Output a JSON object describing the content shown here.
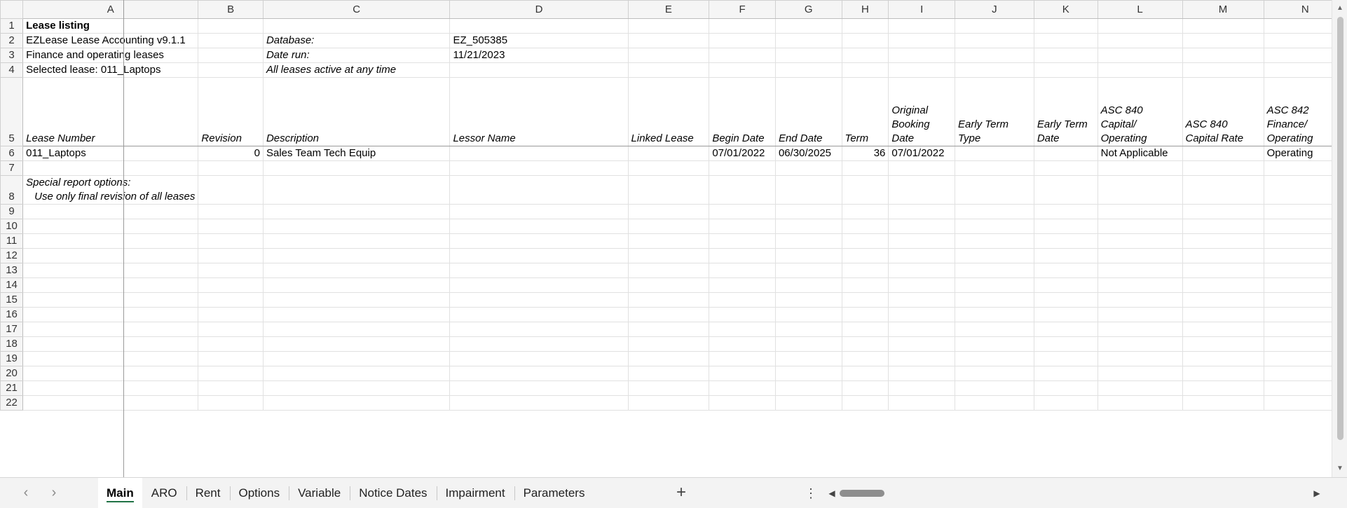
{
  "columns": [
    "A",
    "B",
    "C",
    "D",
    "E",
    "F",
    "G",
    "H",
    "I",
    "J",
    "K",
    "L",
    "M",
    "N"
  ],
  "rows": [
    {
      "num": "1",
      "cells": {
        "A": "Lease listing"
      }
    },
    {
      "num": "2",
      "cells": {
        "A": "EZLease Lease Accounting v9.1.1",
        "C": "Database:",
        "D": "EZ_505385"
      }
    },
    {
      "num": "3",
      "cells": {
        "A": "Finance and operating leases",
        "C": "Date run:",
        "D": "11/21/2023"
      }
    },
    {
      "num": "4",
      "cells": {
        "A": "Selected lease: 011_Laptops",
        "C": "All leases active at any time"
      }
    },
    {
      "num": "5",
      "cells": {
        "A": "Lease Number",
        "B": "Revision",
        "C": "Description",
        "D": "Lessor Name",
        "E": "Linked Lease",
        "F": "Begin Date",
        "G": "End Date",
        "H": "Term",
        "I": "Original Booking Date",
        "J": "Early Term Type",
        "K": "Early Term Date",
        "L": "ASC 840 Capital/ Operating",
        "M": "ASC 840 Capital Rate",
        "N": "ASC 842 Finance/ Operating"
      }
    },
    {
      "num": "6",
      "cells": {
        "A": "011_Laptops",
        "B": "0",
        "C": "Sales Team Tech Equip",
        "F": "07/01/2022",
        "G": "06/30/2025",
        "H": "36",
        "I": "07/01/2022",
        "L": "Not Applicable",
        "N": "Operating"
      }
    },
    {
      "num": "7",
      "cells": {}
    },
    {
      "num": "8",
      "cells": {
        "A_line1": "Special report options:",
        "A_line2": "Use only final revision of all leases"
      }
    },
    {
      "num": "9",
      "cells": {}
    },
    {
      "num": "10",
      "cells": {}
    },
    {
      "num": "11",
      "cells": {}
    },
    {
      "num": "12",
      "cells": {}
    },
    {
      "num": "13",
      "cells": {}
    },
    {
      "num": "14",
      "cells": {}
    },
    {
      "num": "15",
      "cells": {}
    },
    {
      "num": "16",
      "cells": {}
    },
    {
      "num": "17",
      "cells": {}
    },
    {
      "num": "18",
      "cells": {}
    },
    {
      "num": "19",
      "cells": {}
    },
    {
      "num": "20",
      "cells": {}
    },
    {
      "num": "21",
      "cells": {}
    },
    {
      "num": "22",
      "cells": {}
    }
  ],
  "sheet_tabs": [
    {
      "label": "Main",
      "active": true
    },
    {
      "label": "ARO",
      "active": false
    },
    {
      "label": "Rent",
      "active": false
    },
    {
      "label": "Options",
      "active": false
    },
    {
      "label": "Variable",
      "active": false
    },
    {
      "label": "Notice Dates",
      "active": false
    },
    {
      "label": "Impairment",
      "active": false
    },
    {
      "label": "Parameters",
      "active": false
    }
  ],
  "icons": {
    "nav_prev": "‹",
    "nav_next": "›",
    "add_sheet": "+",
    "more_menu": "⋮",
    "scroll_left": "◀",
    "scroll_right": "▶",
    "scroll_up": "▲",
    "scroll_down": "▼"
  },
  "accent_color": "#217346"
}
